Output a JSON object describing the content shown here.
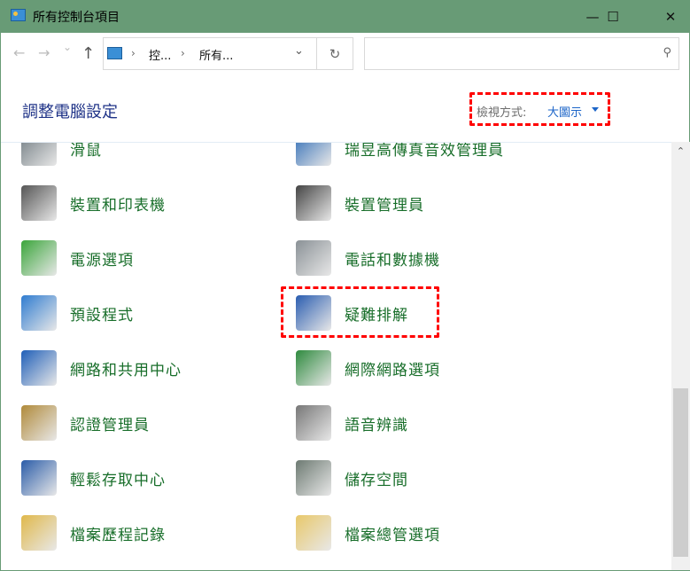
{
  "window": {
    "title": "所有控制台項目",
    "minimize": "—",
    "maximize": "☐",
    "close": "✕"
  },
  "nav": {
    "back": "←",
    "forward": "→",
    "recent": "⌄",
    "up": "↑"
  },
  "address": {
    "crumbs": [
      "控...",
      "所有..."
    ],
    "sep": "›",
    "dropdown": "⌄",
    "refresh": "↻"
  },
  "search": {
    "placeholder": "",
    "icon": "⚲"
  },
  "heading": "調整電腦設定",
  "view_by": {
    "label": "檢視方式:",
    "value": "大圖示"
  },
  "items": [
    {
      "label": "滑鼠",
      "icon": "mouse-icon",
      "color": "#6f7a80"
    },
    {
      "label": "瑞昱高傳真音效管理員",
      "icon": "realtek-audio-icon",
      "color": "#2d6bb5"
    },
    {
      "label": "裝置和印表機",
      "icon": "printer-icon",
      "color": "#555555"
    },
    {
      "label": "裝置管理員",
      "icon": "device-manager-icon",
      "color": "#444444"
    },
    {
      "label": "電源選項",
      "icon": "power-options-icon",
      "color": "#3aa53a"
    },
    {
      "label": "電話和數據機",
      "icon": "phone-modem-icon",
      "color": "#8a9196"
    },
    {
      "label": "預設程式",
      "icon": "default-programs-icon",
      "color": "#2f7cd0"
    },
    {
      "label": "疑難排解",
      "icon": "troubleshooting-icon",
      "color": "#2a5db0"
    },
    {
      "label": "網路和共用中心",
      "icon": "network-center-icon",
      "color": "#1f5fb8"
    },
    {
      "label": "網際網路選項",
      "icon": "internet-options-icon",
      "color": "#2e8a3e"
    },
    {
      "label": "認證管理員",
      "icon": "credential-manager-icon",
      "color": "#b08a3a"
    },
    {
      "label": "語音辨識",
      "icon": "microphone-icon",
      "color": "#777777"
    },
    {
      "label": "輕鬆存取中心",
      "icon": "ease-of-access-icon",
      "color": "#2a5ca8"
    },
    {
      "label": "儲存空間",
      "icon": "storage-spaces-icon",
      "color": "#6d7a72"
    },
    {
      "label": "檔案歷程記錄",
      "icon": "file-history-icon",
      "color": "#e0b84a"
    },
    {
      "label": "檔案總管選項",
      "icon": "folder-options-icon",
      "color": "#e8c86a"
    }
  ],
  "scrollbar": {
    "up": "⌃"
  }
}
